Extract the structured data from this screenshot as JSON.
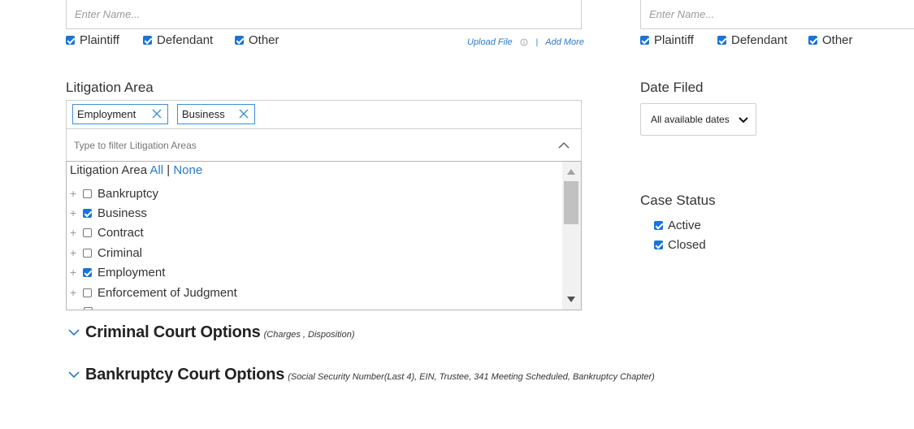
{
  "left_party": {
    "name_placeholder": "Enter Name...",
    "checkboxes": [
      {
        "label": "Plaintiff",
        "checked": true
      },
      {
        "label": "Defendant",
        "checked": true
      },
      {
        "label": "Other",
        "checked": true
      }
    ],
    "upload_label": "Upload File",
    "separator": "|",
    "add_more_label": "Add More"
  },
  "right_party": {
    "name_placeholder": "Enter Name...",
    "checkboxes": [
      {
        "label": "Plaintiff",
        "checked": true
      },
      {
        "label": "Defendant",
        "checked": true
      },
      {
        "label": "Other",
        "checked": true
      }
    ]
  },
  "litigation": {
    "label": "Litigation Area",
    "tags": [
      {
        "label": "Employment"
      },
      {
        "label": "Business"
      }
    ],
    "filter_placeholder": "Type to filter Litigation Areas",
    "list_header": "Litigation Area",
    "all_label": "All",
    "pipe": "|",
    "none_label": "None",
    "items": [
      {
        "label": "Bankruptcy",
        "checked": false
      },
      {
        "label": "Business",
        "checked": true
      },
      {
        "label": "Contract",
        "checked": false
      },
      {
        "label": "Criminal",
        "checked": false
      },
      {
        "label": "Employment",
        "checked": true
      },
      {
        "label": "Enforcement of Judgment",
        "checked": false
      }
    ]
  },
  "date_filed": {
    "label": "Date Filed",
    "selected": "All available dates"
  },
  "case_status": {
    "label": "Case Status",
    "options": [
      {
        "label": "Active",
        "checked": true
      },
      {
        "label": "Closed",
        "checked": true
      }
    ]
  },
  "accordions": [
    {
      "title": "Criminal Court Options",
      "subtitle": "(Charges , Disposition)"
    },
    {
      "title": "Bankruptcy Court Options",
      "subtitle": "(Social Security Number(Last 4), EIN, Trustee, 341 Meeting Scheduled, Bankruptcy Chapter)"
    }
  ],
  "colors": {
    "accent": "#1a73d9",
    "link": "#2a7ac6",
    "tag_border": "#3d8fd6"
  }
}
